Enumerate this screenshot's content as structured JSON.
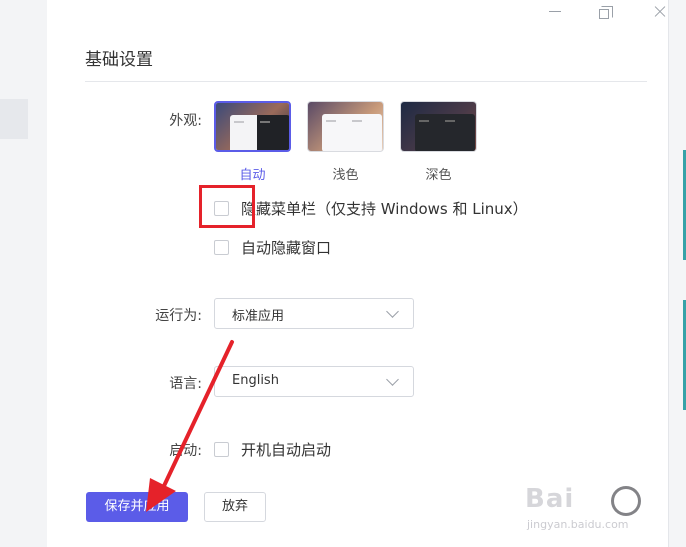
{
  "section": {
    "title": "基础设置"
  },
  "appearance": {
    "label": "外观:",
    "options": [
      {
        "label": "自动",
        "selected": true
      },
      {
        "label": "浅色",
        "selected": false
      },
      {
        "label": "深色",
        "selected": false
      }
    ]
  },
  "checkboxes": {
    "hide_menubar": {
      "label": "隐藏菜单栏（仅支持 Windows 和 Linux）",
      "checked": false
    },
    "auto_hide_window": {
      "label": "自动隐藏窗口",
      "checked": false
    }
  },
  "run_as": {
    "label": "运行为:",
    "value": "标准应用"
  },
  "language": {
    "label": "语言:",
    "value": "English"
  },
  "startup": {
    "label": "启动:",
    "checkbox_label": "开机自动启动",
    "checked": false
  },
  "buttons": {
    "save": "保存并应用",
    "discard": "放弃"
  },
  "watermark": {
    "brand": "Bai",
    "sub": "jingyan.baidu.com"
  },
  "colors": {
    "accent": "#5b5ce8",
    "annotation": "#e5222a"
  }
}
